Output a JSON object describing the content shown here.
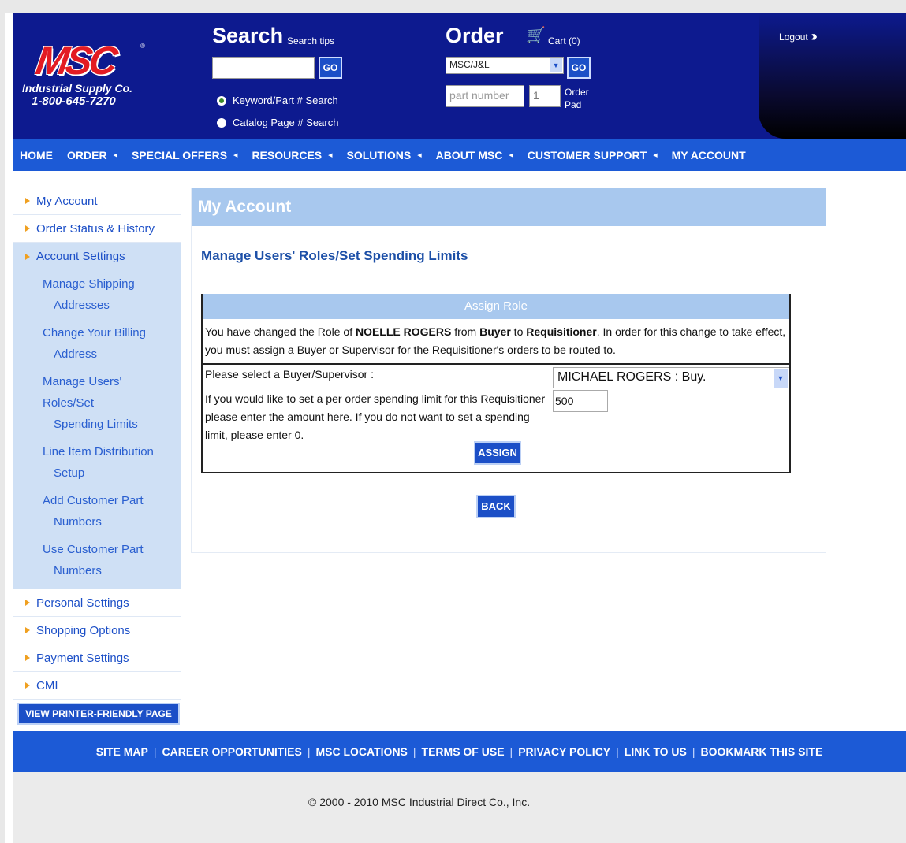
{
  "header": {
    "logo_text": "MSC",
    "logo_reg": "®",
    "company": "Industrial Supply Co.",
    "phone": "1-800-645-7270",
    "search": {
      "title": "Search",
      "tips": "Search tips",
      "go": "GO",
      "options": [
        "Keyword/Part # Search",
        "Catalog Page # Search"
      ],
      "selected": 0
    },
    "order": {
      "title": "Order",
      "cart": "Cart (0)",
      "select_value": "MSC/J&L",
      "go": "GO",
      "part_placeholder": "part number",
      "qty": "1",
      "order_pad": "Order Pad"
    },
    "logout": "Logout"
  },
  "nav": {
    "items": [
      {
        "label": "HOME",
        "dropdown": false
      },
      {
        "label": "ORDER",
        "dropdown": true
      },
      {
        "label": "SPECIAL OFFERS",
        "dropdown": true
      },
      {
        "label": "RESOURCES",
        "dropdown": true
      },
      {
        "label": "SOLUTIONS",
        "dropdown": true
      },
      {
        "label": "ABOUT MSC",
        "dropdown": true
      },
      {
        "label": "CUSTOMER SUPPORT",
        "dropdown": true
      },
      {
        "label": "MY ACCOUNT",
        "dropdown": false
      }
    ]
  },
  "sidebar": {
    "top_items": [
      "My Account",
      "Order Status & History",
      "Account Settings"
    ],
    "sub_items": [
      [
        "Manage Shipping",
        "Addresses"
      ],
      [
        "Change Your Billing",
        "Address"
      ],
      [
        "Manage Users' Roles/Set",
        "Spending Limits"
      ],
      [
        "Line Item Distribution",
        "Setup"
      ],
      [
        "Add Customer Part",
        "Numbers"
      ],
      [
        "Use Customer Part",
        "Numbers"
      ]
    ],
    "bottom_items": [
      "Personal Settings",
      "Shopping Options",
      "Payment Settings",
      "CMI"
    ],
    "printer_button": "VIEW PRINTER-FRIENDLY PAGE"
  },
  "main": {
    "header": "My Account",
    "title": "Manage Users' Roles/Set Spending Limits",
    "assign": {
      "heading": "Assign Role",
      "msg_1": "You have changed the Role of ",
      "user": "NOELLE ROGERS",
      "msg_2": " from ",
      "old_role": "Buyer",
      "msg_3": " to ",
      "new_role": "Requisitioner",
      "msg_4": ". In order for this change to take effect, you must assign a Buyer or Supervisor for the Requisitioner's orders to be routed to.",
      "buyer_label": "Please select a Buyer/Supervisor :",
      "buyer_value": "MICHAEL ROGERS : Buy.",
      "limit_label": "If you would like to set a per order spending limit for this Requisitioner please enter the amount here. If you do not want to set a spending limit, please enter 0.",
      "limit_value": "500",
      "assign_button": "ASSIGN"
    },
    "back_button": "BACK"
  },
  "footer": {
    "links": [
      "SITE MAP",
      "CAREER OPPORTUNITIES",
      "MSC LOCATIONS",
      "TERMS OF USE",
      "PRIVACY POLICY",
      "LINK TO US",
      "BOOKMARK THIS SITE"
    ],
    "copyright": "© 2000 - 2010 MSC Industrial Direct Co., Inc."
  }
}
